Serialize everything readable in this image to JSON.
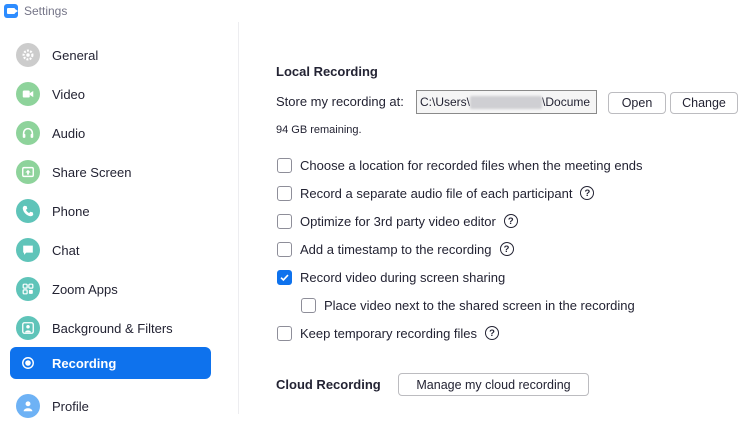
{
  "window": {
    "title": "Settings"
  },
  "sidebar": {
    "items": [
      {
        "label": "General",
        "icon": "gear-icon",
        "color": "#cccccc"
      },
      {
        "label": "Video",
        "icon": "video-camera-icon",
        "color": "#8ed39b"
      },
      {
        "label": "Audio",
        "icon": "headphones-icon",
        "color": "#8ed39b"
      },
      {
        "label": "Share Screen",
        "icon": "share-screen-icon",
        "color": "#8ed39b"
      },
      {
        "label": "Phone",
        "icon": "phone-icon",
        "color": "#5fc4b9"
      },
      {
        "label": "Chat",
        "icon": "chat-icon",
        "color": "#5fc4b9"
      },
      {
        "label": "Zoom Apps",
        "icon": "apps-icon",
        "color": "#5fc4b9"
      },
      {
        "label": "Background & Filters",
        "icon": "person-background-icon",
        "color": "#5fc4b9"
      },
      {
        "label": "Recording",
        "icon": "record-icon",
        "color": "#0e72ed",
        "active": true
      },
      {
        "label": "Profile",
        "icon": "profile-icon",
        "color": "#6eb2f5"
      }
    ]
  },
  "local_recording": {
    "title": "Local Recording",
    "store_label": "Store my recording at:",
    "path_prefix": "C:\\Users\\",
    "path_suffix": "\\Docume",
    "open_label": "Open",
    "change_label": "Change",
    "remaining": "94 GB remaining.",
    "options": [
      {
        "label": "Choose a location for recorded files when the meeting ends",
        "checked": false,
        "help": false
      },
      {
        "label": "Record a separate audio file of each participant",
        "checked": false,
        "help": true
      },
      {
        "label": "Optimize for 3rd party video editor",
        "checked": false,
        "help": true
      },
      {
        "label": "Add a timestamp to the recording",
        "checked": false,
        "help": true
      },
      {
        "label": "Record video during screen sharing",
        "checked": true,
        "help": false
      },
      {
        "label": "Place video next to the shared screen in the recording",
        "checked": false,
        "help": false
      },
      {
        "label": "Keep temporary recording files",
        "checked": false,
        "help": true
      }
    ]
  },
  "cloud_recording": {
    "title": "Cloud Recording",
    "manage_label": "Manage my cloud recording"
  },
  "help_glyph": "?"
}
